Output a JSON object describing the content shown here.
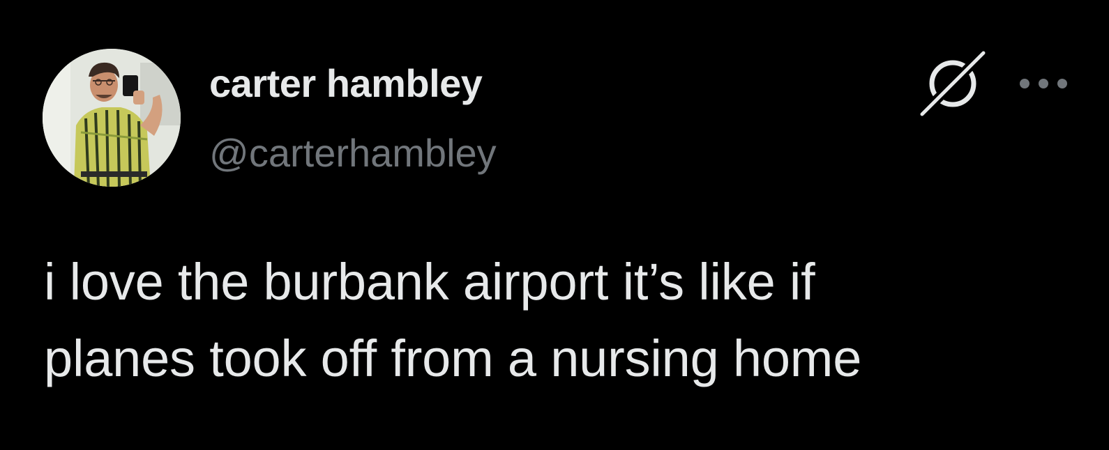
{
  "author": {
    "display_name": "carter hambley",
    "handle": "@carterhambley",
    "avatar_icon": "profile-photo"
  },
  "header_icons": {
    "grok_icon": "grok-slash-circle-icon",
    "more_icon": "more-horizontal-icon"
  },
  "tweet": {
    "text": "i love the burbank airport it’s like if\nplanes took off from a nursing home"
  },
  "colors": {
    "background": "#000000",
    "primary_text": "#e7e9ea",
    "secondary_text": "#71767b"
  }
}
